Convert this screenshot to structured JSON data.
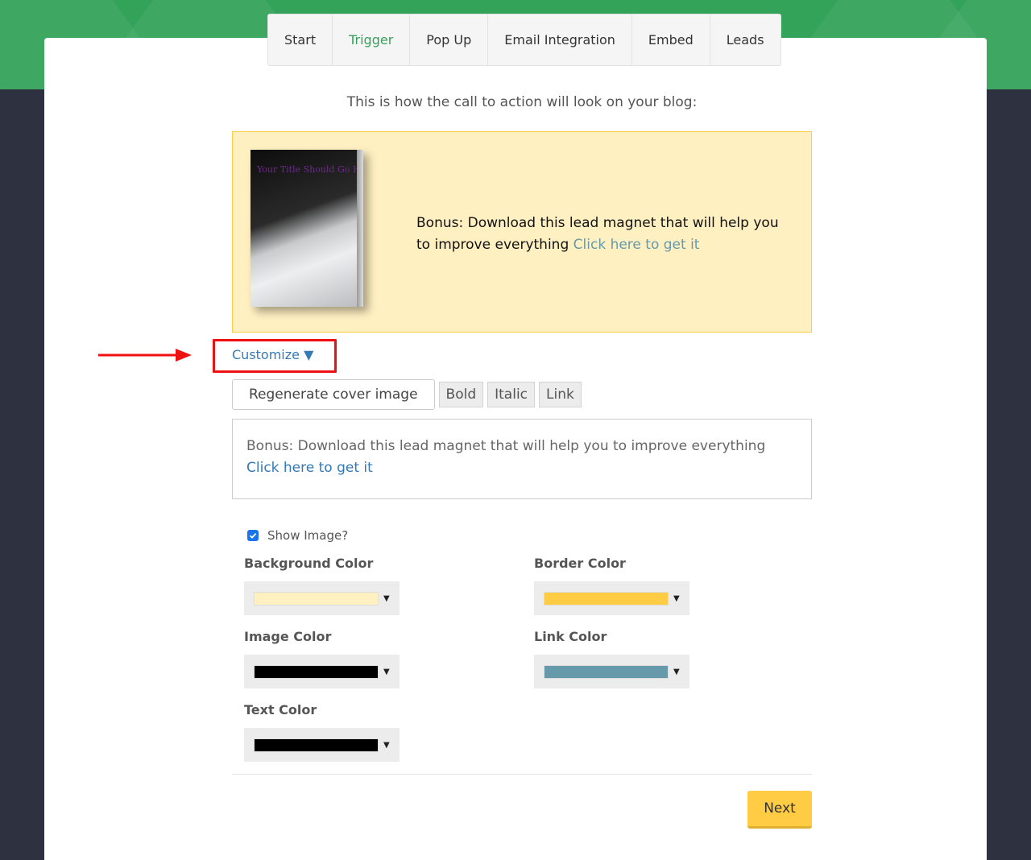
{
  "tabs": [
    {
      "label": "Start"
    },
    {
      "label": "Trigger"
    },
    {
      "label": "Pop Up"
    },
    {
      "label": "Email Integration"
    },
    {
      "label": "Embed"
    },
    {
      "label": "Leads"
    }
  ],
  "active_tab": "Trigger",
  "intro_text": "This is how the call to action will look on your blog:",
  "preview": {
    "book_title": "Your Title Should Go H",
    "text": "Bonus: Download this lead magnet that will help you to improve everything",
    "link_text": "Click here to get it"
  },
  "customize_label": "Customize ▼",
  "toolbar": {
    "regenerate_label": "Regenerate cover image",
    "bold_label": "Bold",
    "italic_label": "Italic",
    "link_label": "Link"
  },
  "editor": {
    "text": "Bonus: Download this lead magnet that will help you to improve everything",
    "link_text": "Click here to get it"
  },
  "show_image_label": "Show Image?",
  "show_image_checked": true,
  "colors": {
    "background_label": "Background Color",
    "background_value": "#fff0c2",
    "border_label": "Border Color",
    "border_value": "#ffcc44",
    "image_label": "Image Color",
    "image_value": "#000000",
    "link_label": "Link Color",
    "link_value": "#6699aa",
    "text_label": "Text Color",
    "text_value": "#000000"
  },
  "next_label": "Next",
  "theme": {
    "brand_green": "#34a35a",
    "dark_bg": "#2d3140",
    "annotation_red": "#ee1111"
  }
}
